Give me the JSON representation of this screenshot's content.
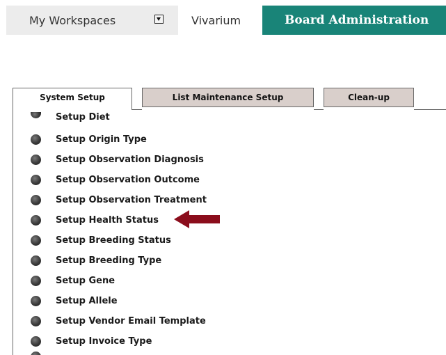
{
  "topnav": {
    "workspaces_label": "My Workspaces",
    "vivarium_label": "Vivarium",
    "board_label": "Board Administration",
    "active_color": "#198478"
  },
  "tabs": [
    {
      "label": "System Setup",
      "active": true
    },
    {
      "label": "List Maintenance Setup",
      "active": false
    },
    {
      "label": "Clean-up",
      "active": false
    }
  ],
  "items": [
    {
      "label": "Setup Diet"
    },
    {
      "label": "Setup Origin Type"
    },
    {
      "label": "Setup Observation Diagnosis"
    },
    {
      "label": "Setup Observation Outcome"
    },
    {
      "label": "Setup Observation Treatment"
    },
    {
      "label": "Setup Health Status"
    },
    {
      "label": "Setup Breeding Status"
    },
    {
      "label": "Setup Breeding Type"
    },
    {
      "label": "Setup Gene"
    },
    {
      "label": "Setup Allele"
    },
    {
      "label": "Setup Vendor Email Template"
    },
    {
      "label": "Setup Invoice Type"
    }
  ],
  "annotation": {
    "arrow_color": "#8b0d1c",
    "points_to": "Setup Health Status"
  }
}
